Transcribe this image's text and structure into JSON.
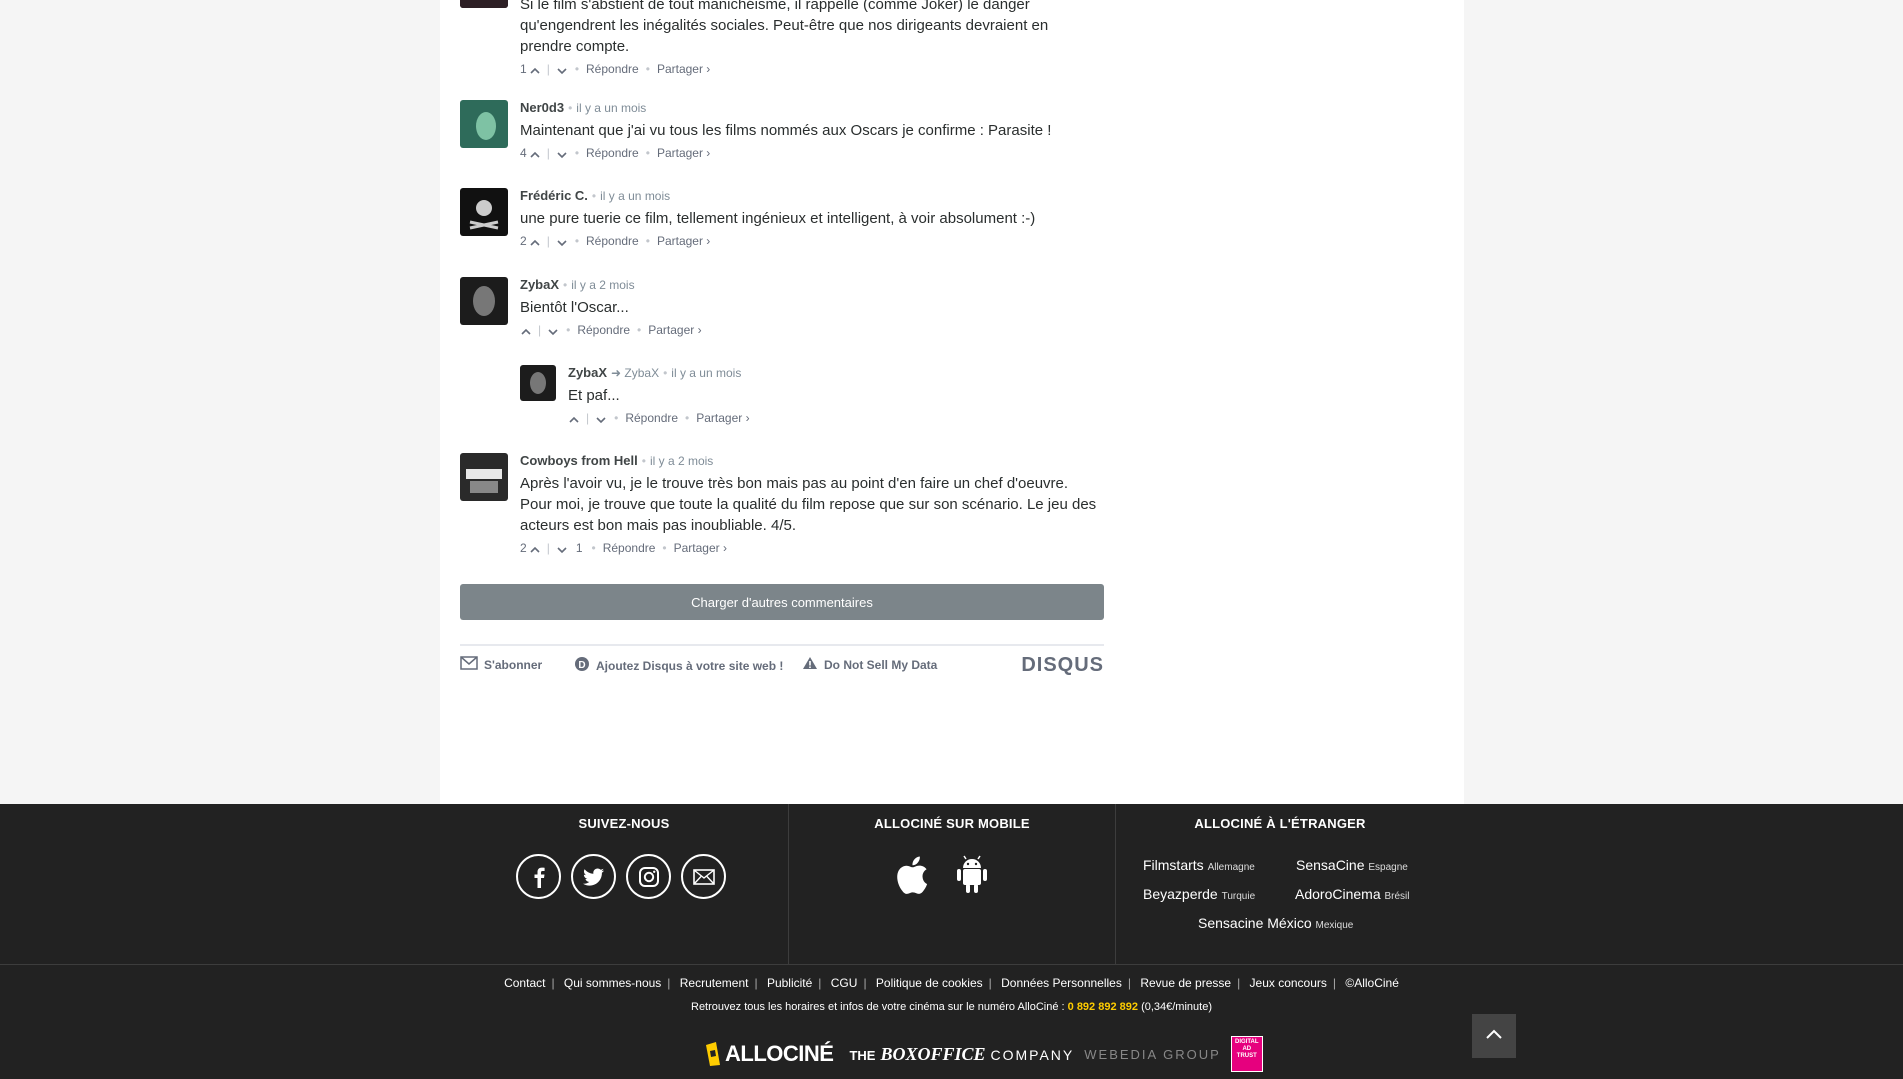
{
  "comments": [
    {
      "author": "",
      "text": "Si le film s'abstient de tout manichéisme, il rappelle (comme Joker) le danger qu'engendrent les inégalités sociales. Peut-être que nos dirigeants devraient en prendre compte.",
      "upvotes": "1",
      "reply_label": "Répondre",
      "share_label": "Partager ›"
    },
    {
      "author": "Ner0d3",
      "time": "il y a un mois",
      "text": "Maintenant que j'ai vu tous les films nommés aux Oscars je confirme : Parasite !",
      "upvotes": "4",
      "reply_label": "Répondre",
      "share_label": "Partager ›"
    },
    {
      "author": "Frédéric C.",
      "time": "il y a un mois",
      "text": "une pure tuerie ce film, tellement ingénieux et intelligent, à voir absolument :-)",
      "upvotes": "2",
      "reply_label": "Répondre",
      "share_label": "Partager ›"
    },
    {
      "author": "ZybaX",
      "time": "il y a 2 mois",
      "text": "Bientôt l'Oscar...",
      "upvotes": "",
      "reply_label": "Répondre",
      "share_label": "Partager ›"
    },
    {
      "author": "ZybaX",
      "reply_to": "ZybaX",
      "time": "il y a un mois",
      "text": "Et paf...",
      "upvotes": "",
      "reply_label": "Répondre",
      "share_label": "Partager ›"
    },
    {
      "author": "Cowboys from Hell",
      "time": "il y a 2 mois",
      "text_line1": "Après l'avoir vu, je le trouve très bon mais pas au point d'en faire un chef d'oeuvre.",
      "text_line2": "Pour moi, je trouve que toute la qualité du film repose que sur son scénario. Le jeu des acteurs est bon mais pas inoubliable. 4/5.",
      "upvotes": "2",
      "downvotes": "1",
      "reply_label": "Répondre",
      "share_label": "Partager ›"
    }
  ],
  "load_more_label": "Charger d'autres commentaires",
  "disqus_footer": {
    "subscribe": "S'abonner",
    "add_disqus": "Ajoutez Disqus à votre site web !",
    "do_not_sell": "Do Not Sell My Data",
    "logo": "DISQUS"
  },
  "footer": {
    "follow_title": "SUIVEZ-NOUS",
    "mobile_title": "ALLOCINÉ SUR MOBILE",
    "abroad_title": "ALLOCINÉ À L'ÉTRANGER",
    "abroad_sites": [
      {
        "name": "Filmstarts",
        "country": "Allemagne"
      },
      {
        "name": "SensaCine",
        "country": "Espagne"
      },
      {
        "name": "Beyazperde",
        "country": "Turquie"
      },
      {
        "name": "AdoroCinema",
        "country": "Brésil"
      },
      {
        "name": "Sensacine México",
        "country": "Mexique"
      }
    ],
    "links": [
      "Contact",
      "Qui sommes-nous",
      "Recrutement",
      "Publicité",
      "CGU",
      "Politique de cookies",
      "Données Personnelles",
      "Revue de presse",
      "Jeux concours",
      "©AlloCiné"
    ],
    "info_text": "Retrouvez tous les horaires et infos de votre cinéma sur le numéro AlloCiné :",
    "phone": "0 892 892 892",
    "rate": "(0,34€/minute)",
    "brand_allocine": "ALLOCINÉ",
    "brand_the": "THE",
    "brand_boxoffice": "BOXOFFICE",
    "brand_company": "COMPANY",
    "brand_webedia": "WEBEDIA GROUP",
    "brand_dat": "DIGITAL AD TRUST"
  },
  "colors": {
    "phone": "#fecc00",
    "footer_bg": "#222222",
    "button_bg": "#7c858a"
  }
}
